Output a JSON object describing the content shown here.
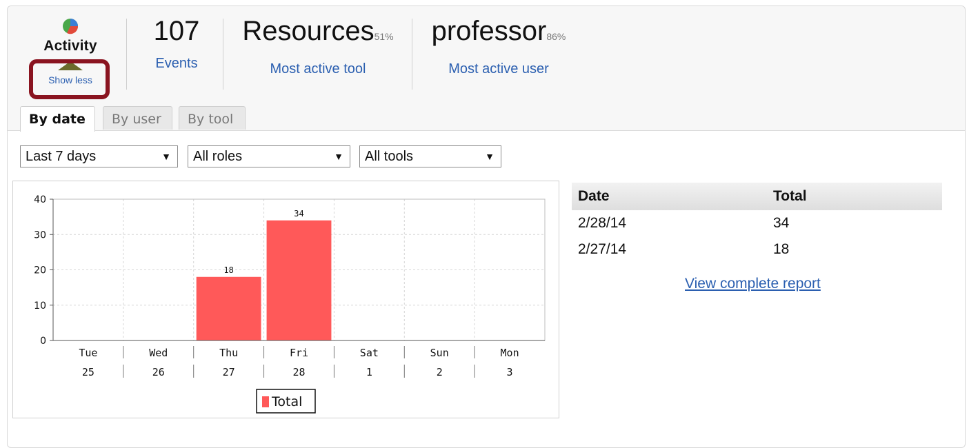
{
  "summary": {
    "activity_title": "Activity",
    "show_less_label": "Show less",
    "events_count": "107",
    "events_label": "Events",
    "top_tool_name": "Resources",
    "top_tool_pct": "51%",
    "top_tool_label": "Most active tool",
    "top_user_name": "professor",
    "top_user_pct": "86%",
    "top_user_label": "Most active user"
  },
  "tabs": [
    {
      "label": "By date",
      "active": true
    },
    {
      "label": "By user",
      "active": false
    },
    {
      "label": "By tool",
      "active": false
    }
  ],
  "filters": {
    "period": "Last 7 days",
    "roles": "All roles",
    "tools": "All tools"
  },
  "chart_data": {
    "type": "bar",
    "categories": [
      "Tue 25",
      "Wed 26",
      "Thu 27",
      "Fri 28",
      "Sat 1",
      "Sun 2",
      "Mon 3"
    ],
    "day_labels": [
      "Tue",
      "Wed",
      "Thu",
      "Fri",
      "Sat",
      "Sun",
      "Mon"
    ],
    "date_labels": [
      "25",
      "26",
      "27",
      "28",
      "1",
      "2",
      "3"
    ],
    "series": [
      {
        "name": "Total",
        "values": [
          0,
          0,
          18,
          34,
          0,
          0,
          0
        ],
        "color": "#ff5959"
      }
    ],
    "data_labels": [
      "",
      "",
      "18",
      "34",
      "",
      "",
      ""
    ],
    "yticks": [
      "0",
      "10",
      "20",
      "30",
      "40"
    ],
    "ylim": [
      0,
      40
    ],
    "grid": true,
    "legend": "bottom-center"
  },
  "table": {
    "headers": [
      "Date",
      "Total"
    ],
    "rows": [
      [
        "2/28/14",
        "34"
      ],
      [
        "2/27/14",
        "18"
      ]
    ]
  },
  "report_link": "View complete report",
  "colors": {
    "link": "#2b5fb0",
    "bar": "#ff5959",
    "highlight": "#8a1420",
    "triangle": "#6b6b2c"
  }
}
